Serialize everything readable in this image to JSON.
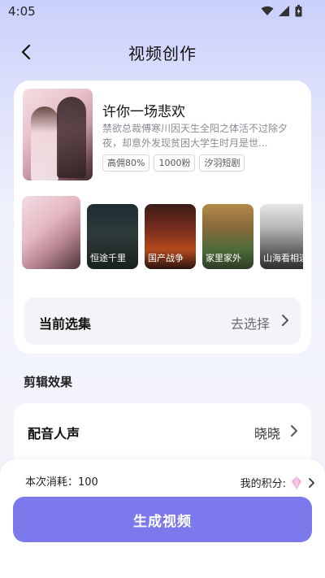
{
  "status_bar": {
    "time": "4:05"
  },
  "header": {
    "title": "视频创作"
  },
  "drama": {
    "title": "许你一场悲欢",
    "description": "禁欲总裁傅寒川因天生全阳之体活不过除夕夜，却意外发现贫困大学生时月是世...",
    "tags": [
      "高佣80%",
      "1000粉",
      "汐羽短剧"
    ],
    "thumbnails": [
      {
        "caption": ""
      },
      {
        "caption": "恒途千里"
      },
      {
        "caption": "国产战争"
      },
      {
        "caption": "家里家外"
      },
      {
        "caption": "山海看相逢"
      }
    ]
  },
  "episode": {
    "label": "当前选集",
    "action": "去选择"
  },
  "edit_section": {
    "title": "剪辑效果"
  },
  "voice": {
    "label": "配音人声",
    "value": "晓晓"
  },
  "footer": {
    "cost": "本次消耗：100",
    "points_label": "我的积分:",
    "generate_label": "生成视频"
  },
  "colors": {
    "accent": "#7b79ec",
    "background_top": "#c9d0fb"
  }
}
